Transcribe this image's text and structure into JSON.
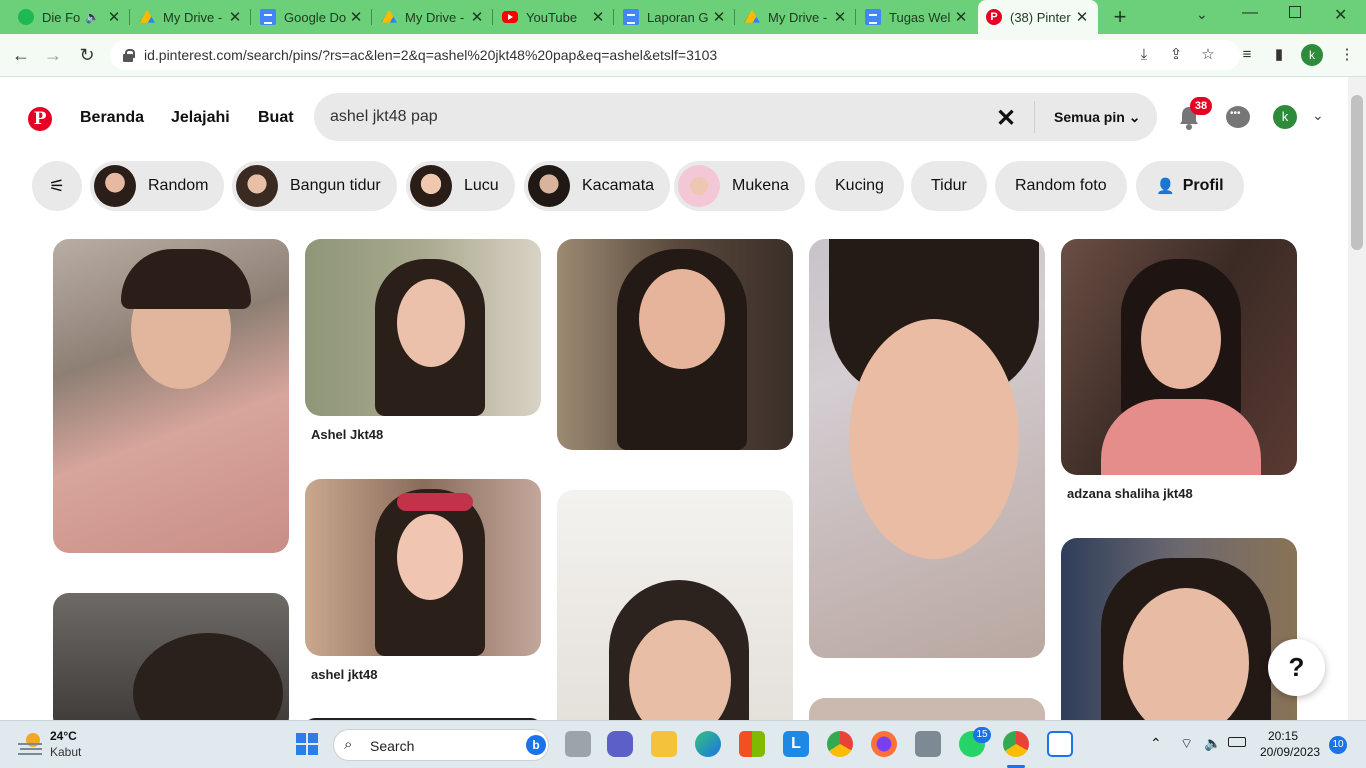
{
  "browser": {
    "tabs": [
      {
        "title": "Die Fo",
        "icon": "spotify-icon"
      },
      {
        "title": "My Drive -",
        "icon": "google-drive-icon"
      },
      {
        "title": "Google Do",
        "icon": "google-docs-icon"
      },
      {
        "title": "My Drive -",
        "icon": "google-drive-icon"
      },
      {
        "title": "YouTube",
        "icon": "youtube-icon"
      },
      {
        "title": "Laporan G",
        "icon": "google-docs-icon"
      },
      {
        "title": "My Drive -",
        "icon": "google-drive-icon"
      },
      {
        "title": "Tugas Wel",
        "icon": "google-docs-icon"
      },
      {
        "title": "(38) Pinter",
        "icon": "pinterest-icon"
      }
    ],
    "new_tab": "+",
    "url": "id.pinterest.com/search/pins/?rs=ac&len=2&q=ashel%20jkt48%20pap&eq=ashel&etslf=3103",
    "profile_initial": "k"
  },
  "header": {
    "logo": "P",
    "nav": [
      "Beranda",
      "Jelajahi",
      "Buat"
    ],
    "search_value": "ashel jkt48 pap",
    "scope": "Semua pin",
    "notifications": "38",
    "avatar_initial": "k"
  },
  "chips": [
    {
      "label": "Random",
      "thumb": true
    },
    {
      "label": "Bangun tidur",
      "thumb": true
    },
    {
      "label": "Lucu",
      "thumb": true
    },
    {
      "label": "Kacamata",
      "thumb": true
    },
    {
      "label": "Mukena",
      "thumb": true
    },
    {
      "label": "Kucing",
      "thumb": false
    },
    {
      "label": "Tidur",
      "thumb": false
    },
    {
      "label": "Random foto",
      "thumb": false
    },
    {
      "label": "Profil",
      "thumb": false
    }
  ],
  "pins": {
    "captions": {
      "c2a": "Ashel Jkt48",
      "c2b": "ashel jkt48",
      "c5a": "adzana shaliha jkt48"
    }
  },
  "help_label": "?",
  "taskbar": {
    "weather_temp": "24°C",
    "weather_desc": "Kabut",
    "search_label": "Search",
    "whatsapp_badge": "15",
    "clock_time": "20:15",
    "clock_date": "20/09/2023",
    "notif_count": "10"
  }
}
